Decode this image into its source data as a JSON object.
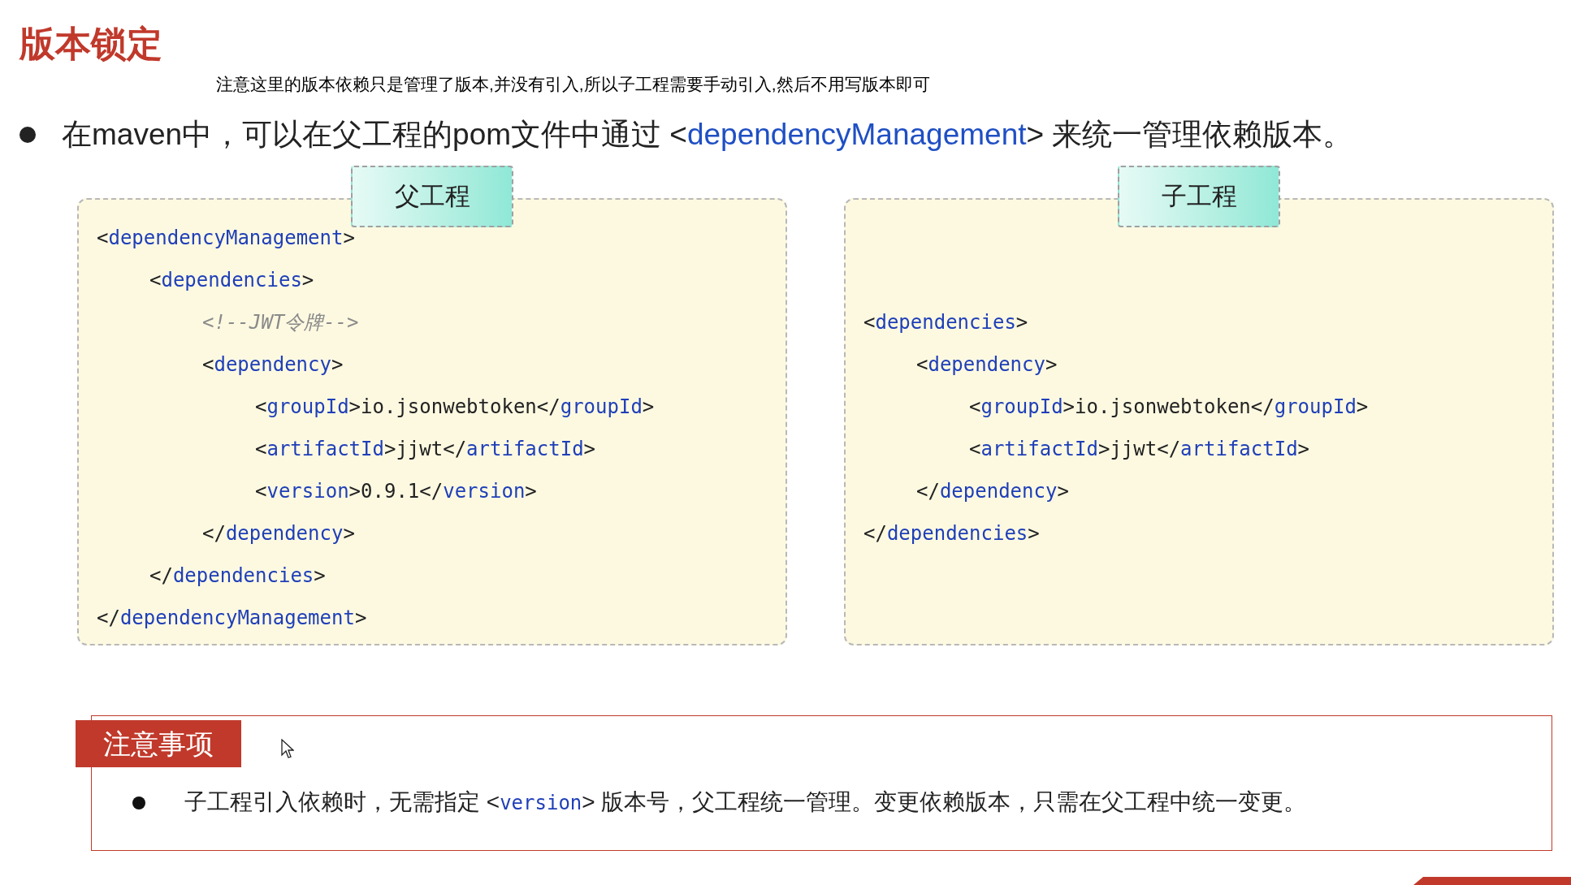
{
  "title": "版本锁定",
  "annotation": "注意这里的版本依赖只是管理了版本,并没有引入,所以子工程需要手动引入,然后不用写版本即可",
  "intro": {
    "before": "在maven中，可以在父工程的pom文件中通过 <",
    "highlight": "dependencyManagement",
    "after": "> 来统一管理依赖版本。"
  },
  "panels": [
    {
      "tab": "父工程",
      "code": [
        {
          "open": [
            {
              "kind": "punct",
              "text": "<"
            },
            {
              "kind": "tag",
              "text": "dependencyManagement"
            },
            {
              "kind": "punct",
              "text": ">"
            }
          ],
          "children": [
            {
              "open": [
                {
                  "kind": "punct",
                  "text": "<"
                },
                {
                  "kind": "tag",
                  "text": "dependencies"
                },
                {
                  "kind": "punct",
                  "text": ">"
                }
              ],
              "children": [
                {
                  "open": [
                    {
                      "kind": "comment",
                      "text": "<!--JWT令牌-->"
                    }
                  ]
                },
                {
                  "open": [
                    {
                      "kind": "punct",
                      "text": "<"
                    },
                    {
                      "kind": "tag",
                      "text": "dependency"
                    },
                    {
                      "kind": "punct",
                      "text": ">"
                    }
                  ],
                  "children": [
                    {
                      "open": [
                        {
                          "kind": "punct",
                          "text": "<"
                        },
                        {
                          "kind": "tag",
                          "text": "groupId"
                        },
                        {
                          "kind": "punct",
                          "text": ">io.jsonwebtoken</"
                        },
                        {
                          "kind": "tag",
                          "text": "groupId"
                        },
                        {
                          "kind": "punct",
                          "text": ">"
                        }
                      ]
                    },
                    {
                      "open": [
                        {
                          "kind": "punct",
                          "text": "<"
                        },
                        {
                          "kind": "tag",
                          "text": "artifactId"
                        },
                        {
                          "kind": "punct",
                          "text": ">jjwt</"
                        },
                        {
                          "kind": "tag",
                          "text": "artifactId"
                        },
                        {
                          "kind": "punct",
                          "text": ">"
                        }
                      ]
                    },
                    {
                      "open": [
                        {
                          "kind": "punct",
                          "text": "<"
                        },
                        {
                          "kind": "tag",
                          "text": "version"
                        },
                        {
                          "kind": "punct",
                          "text": ">0.9.1</"
                        },
                        {
                          "kind": "tag",
                          "text": "version"
                        },
                        {
                          "kind": "punct",
                          "text": ">"
                        }
                      ]
                    }
                  ],
                  "close": [
                    {
                      "kind": "punct",
                      "text": "</"
                    },
                    {
                      "kind": "tag",
                      "text": "dependency"
                    },
                    {
                      "kind": "punct",
                      "text": ">"
                    }
                  ]
                }
              ],
              "close": [
                {
                  "kind": "punct",
                  "text": "</"
                },
                {
                  "kind": "tag",
                  "text": "dependencies"
                },
                {
                  "kind": "punct",
                  "text": ">"
                }
              ]
            }
          ],
          "close": [
            {
              "kind": "punct",
              "text": "</"
            },
            {
              "kind": "tag",
              "text": "dependencyManagement"
            },
            {
              "kind": "punct",
              "text": ">"
            }
          ]
        }
      ]
    },
    {
      "tab": "子工程",
      "code": [
        {
          "open": [
            {
              "kind": "punct",
              "text": "<"
            },
            {
              "kind": "tag",
              "text": "dependencies"
            },
            {
              "kind": "punct",
              "text": ">"
            }
          ],
          "children": [
            {
              "open": [
                {
                  "kind": "punct",
                  "text": "<"
                },
                {
                  "kind": "tag",
                  "text": "dependency"
                },
                {
                  "kind": "punct",
                  "text": ">"
                }
              ],
              "children": [
                {
                  "open": [
                    {
                      "kind": "punct",
                      "text": "<"
                    },
                    {
                      "kind": "tag",
                      "text": "groupId"
                    },
                    {
                      "kind": "punct",
                      "text": ">io.jsonwebtoken</"
                    },
                    {
                      "kind": "tag",
                      "text": "groupId"
                    },
                    {
                      "kind": "punct",
                      "text": ">"
                    }
                  ]
                },
                {
                  "open": [
                    {
                      "kind": "punct",
                      "text": "<"
                    },
                    {
                      "kind": "tag",
                      "text": "artifactId"
                    },
                    {
                      "kind": "punct",
                      "text": ">jjwt</"
                    },
                    {
                      "kind": "tag",
                      "text": "artifactId"
                    },
                    {
                      "kind": "punct",
                      "text": ">"
                    }
                  ]
                }
              ],
              "close": [
                {
                  "kind": "punct",
                  "text": "</"
                },
                {
                  "kind": "tag",
                  "text": "dependency"
                },
                {
                  "kind": "punct",
                  "text": ">"
                }
              ]
            }
          ],
          "close": [
            {
              "kind": "punct",
              "text": "</"
            },
            {
              "kind": "tag",
              "text": "dependencies"
            },
            {
              "kind": "punct",
              "text": ">"
            }
          ]
        }
      ]
    }
  ],
  "notes": {
    "label": "注意事项",
    "items": [
      {
        "before": "子工程引入依赖时，无需指定 <",
        "highlight": "version",
        "after": "> 版本号，父工程统一管理。变更依赖版本，只需在父工程中统一变更。"
      }
    ]
  }
}
